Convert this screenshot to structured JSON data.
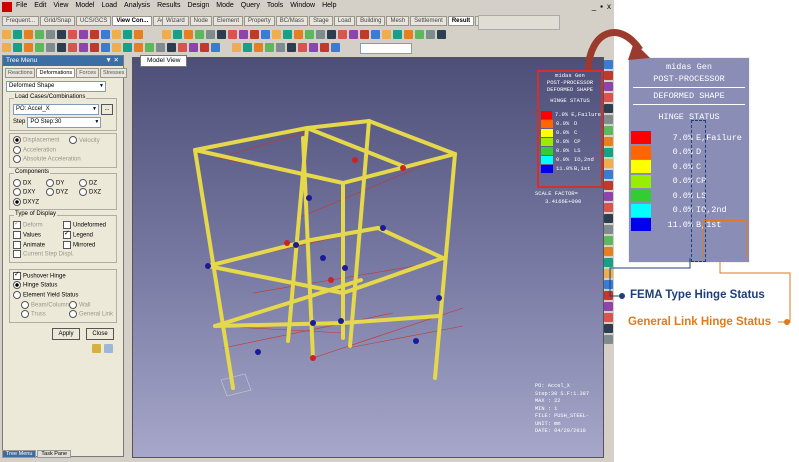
{
  "menubar": {
    "items": [
      "File",
      "Edit",
      "View",
      "Model",
      "Load",
      "Analysis",
      "Results",
      "Design",
      "Mode",
      "Query",
      "Tools",
      "Window",
      "Help"
    ],
    "window_controls": [
      "_",
      "▪",
      "x"
    ]
  },
  "tabs_left": [
    "Frequent...",
    "Grid/Snap",
    "UCS/GCS",
    "View Con...",
    "Activation"
  ],
  "tabs_right": [
    "Wizard",
    "Node",
    "Element",
    "Property",
    "BC/Mass",
    "Stage",
    "Load",
    "Building",
    "Mesh",
    "Settlement",
    "Result",
    "Query"
  ],
  "tree_menu": {
    "title": "Tree Menu",
    "controls": "▼ ✕",
    "subtabs": [
      "Reactions",
      "Deformations",
      "Forces",
      "Stresses"
    ],
    "result_type": "Deformed Shape",
    "lc_label": "Load Cases/Combinations",
    "lc_value": "PO: Accel_X",
    "step_label": "Step",
    "step_value": "PO Step:30",
    "disp_options": [
      "Displacement",
      "Velocity",
      "Acceleration",
      "Absolute Acceleration"
    ],
    "components_label": "Components",
    "components": [
      "DX",
      "DY",
      "DZ",
      "DXY",
      "DYZ",
      "DXZ",
      "DXYZ"
    ],
    "display_label": "Type of Display",
    "display_opts": [
      "Deform",
      "Undeformed",
      "Values",
      "Legend",
      "Animate",
      "Mirrored",
      "Current Step Displ."
    ],
    "pushover_hinge": "Pushover Hinge",
    "hinge_status": "Hinge Status",
    "element_yield": "Element Yield Status",
    "yield_opts": [
      "Beam/Column",
      "Wall",
      "Truss",
      "General Link"
    ],
    "apply": "Apply",
    "close": "Close",
    "ellipsis": "...",
    "radio_group": "C"
  },
  "bottom_tabs": [
    "Tree Menu",
    "Task Pane"
  ],
  "model_view": {
    "tab": "Model View",
    "legend_header": [
      "midas Gen",
      "POST-PROCESSOR",
      "DEFORMED SHAPE"
    ],
    "legend_title": "HINGE STATUS",
    "legend_rows": [
      {
        "value": "7.0%",
        "label": "E,Failure",
        "color": "#ff0000"
      },
      {
        "value": "0.0%",
        "label": "D",
        "color": "#ff6600"
      },
      {
        "value": "0.0%",
        "label": "C",
        "color": "#ffff00"
      },
      {
        "value": "0.0%",
        "label": "CP",
        "color": "#99ee00"
      },
      {
        "value": "0.0%",
        "label": "LS",
        "color": "#33cc33"
      },
      {
        "value": "0.0%",
        "label": "IO,2nd",
        "color": "#00ffff"
      },
      {
        "value": "11.0%",
        "label": "B,1st",
        "color": "#0000ee"
      }
    ],
    "scale_factor_label": "SCALE FACTOR=",
    "scale_factor": "3.4166E+000",
    "info": [
      "PO: Accel_X",
      "Step:30 S.F:1.387",
      "MAX : 22",
      "MIN : 1",
      "FILE: PUSH_STEEL-",
      "UNIT: mm",
      "DATE: 04/29/2010"
    ]
  },
  "zoom": {
    "header": [
      "midas Gen",
      "POST-PROCESSOR",
      "DEFORMED SHAPE"
    ],
    "title": "HINGE STATUS",
    "rows": [
      {
        "value": "7.0%",
        "label": "E,Failure",
        "color": "#ff0000"
      },
      {
        "value": "0.0%",
        "label": "D",
        "color": "#ff6600"
      },
      {
        "value": "0.0%",
        "label": "C",
        "color": "#ffff00"
      },
      {
        "value": "0.0%",
        "label": "CP",
        "color": "#99ee00"
      },
      {
        "value": "0.0%",
        "label": "LS",
        "color": "#33cc33"
      },
      {
        "value": "0.0%",
        "label": "IO,2nd",
        "color": "#00ffff"
      },
      {
        "value": "11.0%",
        "label": "B,1st",
        "color": "#0000ee"
      }
    ]
  },
  "callouts": {
    "fema": "FEMA Type Hinge Status",
    "general": "General Link Hinge Status",
    "fema_color": "#1f3f7a",
    "general_color": "#e07a1f",
    "arrow_color": "#9b3b2e"
  }
}
